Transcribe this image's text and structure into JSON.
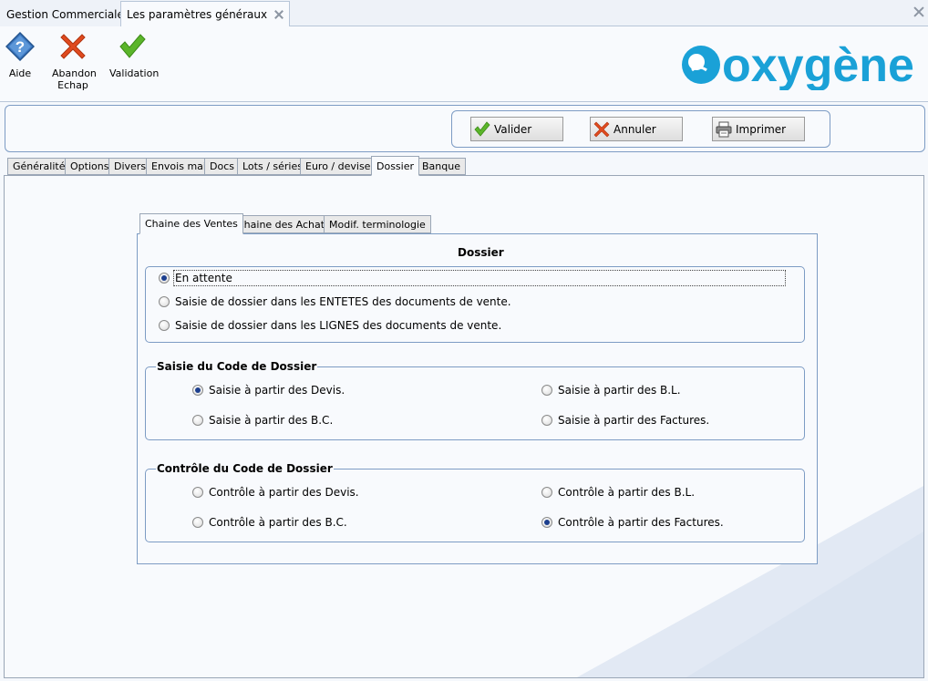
{
  "doc_tabs": [
    {
      "label": "Gestion Commerciale",
      "active": false
    },
    {
      "label": "Les paramètres généraux",
      "active": true
    }
  ],
  "ribbon": {
    "aide": "Aide",
    "abandon_line1": "Abandon",
    "abandon_line2": "Echap",
    "validation": "Validation",
    "logo_text": "oxygène"
  },
  "actions": {
    "valider": "Valider",
    "annuler": "Annuler",
    "imprimer": "Imprimer"
  },
  "main_tabs": [
    "Généralités",
    "Options",
    "Divers",
    "Envois mail",
    "Docs",
    "Lots / séries",
    "Euro / devises",
    "Dossier",
    "Banque"
  ],
  "main_tab_active": "Dossier",
  "inner_tabs": [
    "Chaine des Ventes",
    "Chaine des Achats",
    "Modif. terminologie"
  ],
  "inner_tab_active": "Chaine des Ventes",
  "dossier": {
    "title": "Dossier",
    "options": [
      {
        "label": "En attente",
        "selected": true
      },
      {
        "label": "Saisie de dossier dans les ENTETES des documents de vente.",
        "selected": false
      },
      {
        "label": "Saisie de dossier dans les LIGNES des documents de vente.",
        "selected": false
      }
    ]
  },
  "saisie": {
    "title": "Saisie du Code de Dossier",
    "devis": {
      "label": "Saisie à partir des Devis.",
      "selected": true
    },
    "bl": {
      "label": "Saisie à partir des B.L.",
      "selected": false
    },
    "bc": {
      "label": "Saisie à partir des B.C.",
      "selected": false
    },
    "factures": {
      "label": "Saisie à partir des Factures.",
      "selected": false
    }
  },
  "controle": {
    "title": "Contrôle du Code de Dossier",
    "devis": {
      "label": "Contrôle à partir des Devis.",
      "selected": false
    },
    "bl": {
      "label": "Contrôle à partir des B.L.",
      "selected": false
    },
    "bc": {
      "label": "Contrôle à partir des B.C.",
      "selected": false
    },
    "factures": {
      "label": "Contrôle à partir des Factures.",
      "selected": true
    }
  },
  "colors": {
    "accent": "#1c3f8e",
    "border": "#7d9cc4",
    "logo": "#1aa1d7",
    "check_green": "#5bb52a",
    "cross_red": "#e04a1f"
  }
}
